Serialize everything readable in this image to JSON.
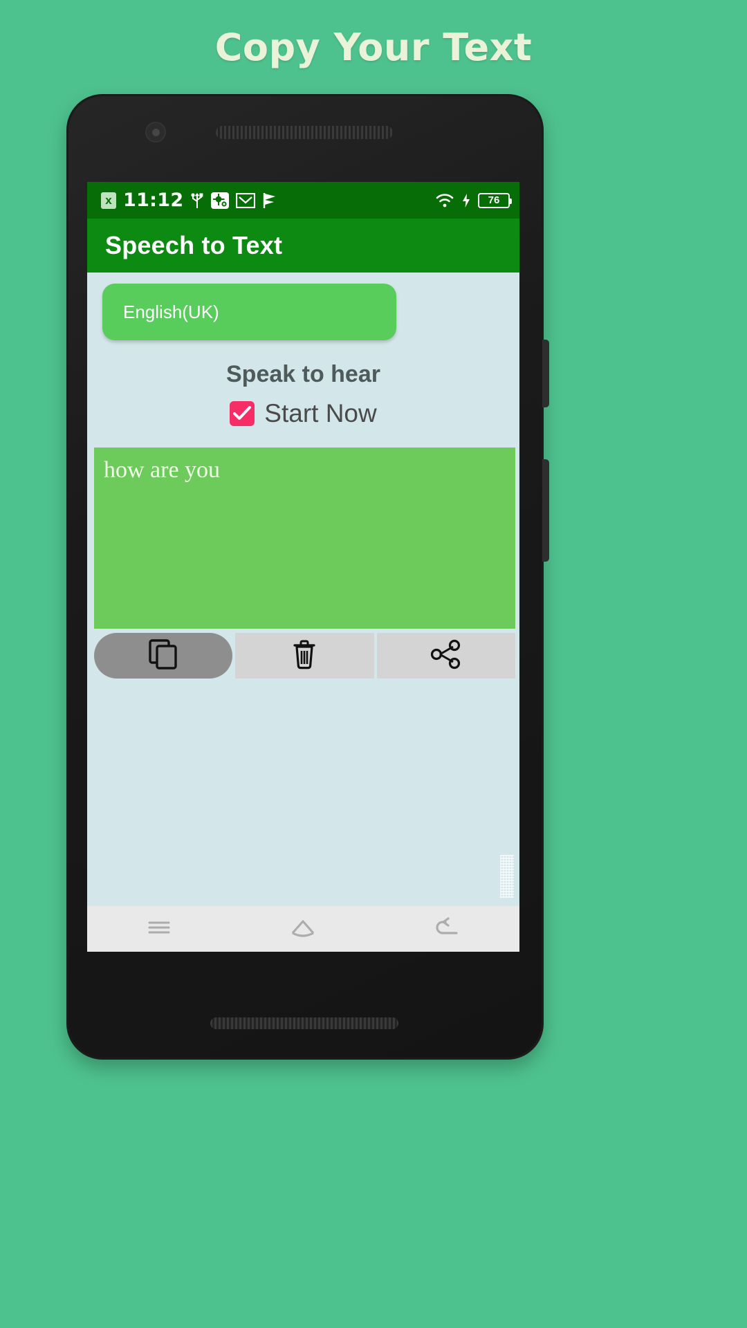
{
  "banner": {
    "title": "Copy Your Text",
    "background_color": "#4ec28e",
    "text_color": "#eaf2d8"
  },
  "status_bar": {
    "badge_text": "x",
    "time": "11:12",
    "left_icons": [
      "usb-icon",
      "debug-bug-icon",
      "gmail-icon",
      "flag-icon"
    ],
    "right_icons": [
      "wifi-icon",
      "charging-bolt-icon"
    ],
    "battery_level": "76",
    "background_color": "#076d07"
  },
  "app_bar": {
    "title": "Speech to Text",
    "background_color": "#0c8a12"
  },
  "main": {
    "language_spinner": {
      "value": "English(UK)",
      "background_color": "#58cd5c"
    },
    "heading": "Speak to hear",
    "start_checkbox": {
      "label": "Start Now",
      "checked": true,
      "color": "#f72d68"
    },
    "transcript": {
      "text": "how are you",
      "background_color": "#6dcb5c"
    },
    "action_buttons": [
      {
        "name": "copy",
        "icon": "copy-icon",
        "active": true
      },
      {
        "name": "delete",
        "icon": "trash-icon",
        "active": false
      },
      {
        "name": "share",
        "icon": "share-icon",
        "active": false
      }
    ],
    "background_color": "#d3e6e9"
  },
  "nav_bar": {
    "items": [
      "menu-icon",
      "home-icon",
      "back-icon"
    ],
    "background_color": "#e9e9e9"
  }
}
